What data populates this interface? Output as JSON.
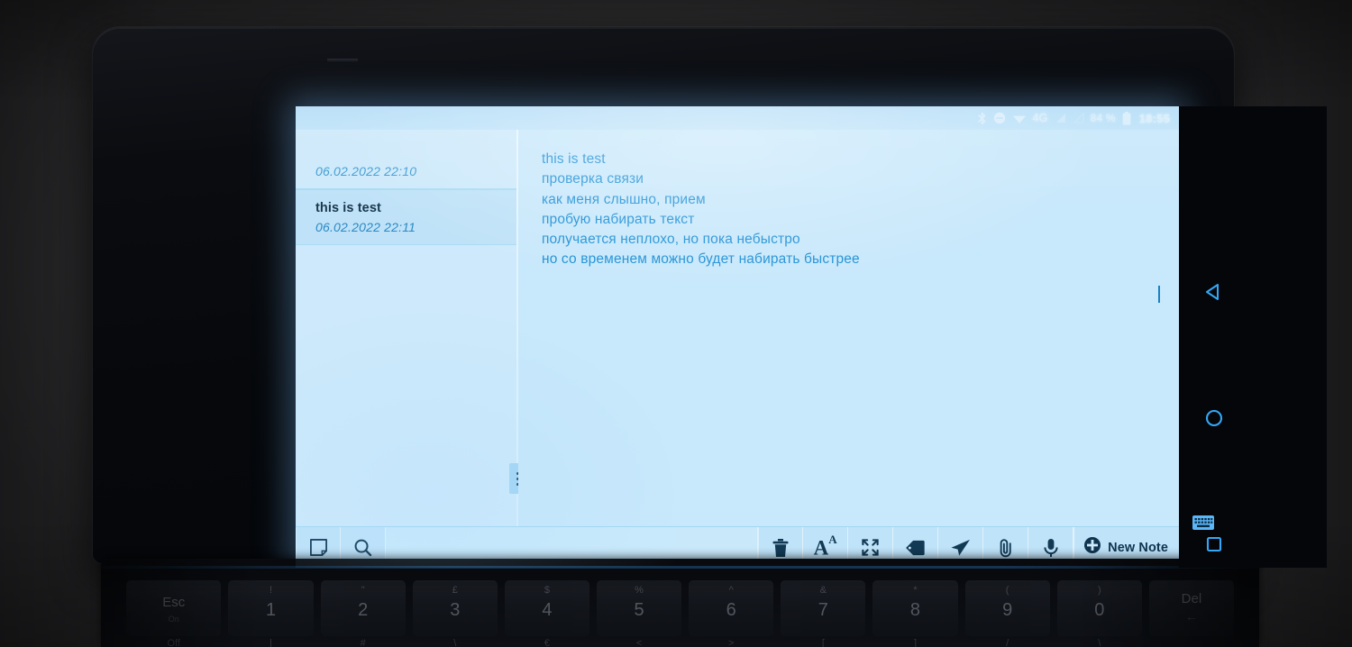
{
  "device": {
    "kind": "foldable-phone-with-keyboard"
  },
  "status_bar": {
    "bluetooth_icon": "bluetooth-icon",
    "dnd_icon": "do-not-disturb-icon",
    "wifi_icon": "wifi-icon",
    "network_label": "4G",
    "signal_icon": "signal-bars-icon",
    "signal_secondary_icon": "signal-bars-secondary-icon",
    "battery_percent": "84 %",
    "battery_icon": "battery-icon",
    "clock": "18:55"
  },
  "notes_list": {
    "items": [
      {
        "title": "",
        "date": "06.02.2022 22:10",
        "selected": false
      },
      {
        "title": "this is test",
        "date": "06.02.2022 22:11",
        "selected": true
      }
    ]
  },
  "editor": {
    "body": "this is test\nпроверка связи\nкак меня слышно, прием\nпробую набирать текст\nполучается неплохо, но пока небыстро\nно со временем можно будет набирать быстрее"
  },
  "toolbar": {
    "left_buttons": [
      {
        "name": "note-icon",
        "label": "Note"
      },
      {
        "name": "search-icon",
        "label": "Search"
      }
    ],
    "right_buttons": [
      {
        "name": "trash-icon",
        "label": "Delete"
      },
      {
        "name": "font-size-icon",
        "label": "Font Size",
        "glyph": "A",
        "glyph_sup": "A"
      },
      {
        "name": "fullscreen-icon",
        "label": "Fullscreen"
      },
      {
        "name": "tag-icon",
        "label": "Tag"
      },
      {
        "name": "send-icon",
        "label": "Send"
      },
      {
        "name": "attachment-icon",
        "label": "Attach"
      },
      {
        "name": "microphone-icon",
        "label": "Voice"
      }
    ],
    "new_note_label": "New Note",
    "new_note_icon": "plus-circle-icon"
  },
  "navbar": {
    "back_icon": "back-triangle-icon",
    "home_icon": "home-circle-icon",
    "recents_icon": "recents-square-icon",
    "keyboard_icon": "keyboard-icon"
  },
  "keyboard": {
    "keys": [
      {
        "main": "Esc",
        "shift": "",
        "sub": "On",
        "alt": "Off",
        "class": "is-esc"
      },
      {
        "main": "1",
        "shift": "!",
        "sub": "",
        "alt": "|",
        "class": ""
      },
      {
        "main": "2",
        "shift": "\"",
        "sub": "",
        "alt": "#",
        "class": ""
      },
      {
        "main": "3",
        "shift": "£",
        "sub": "",
        "alt": "\\",
        "class": ""
      },
      {
        "main": "4",
        "shift": "$",
        "sub": "",
        "alt": "€",
        "class": ""
      },
      {
        "main": "5",
        "shift": "%",
        "sub": "",
        "alt": "<",
        "class": ""
      },
      {
        "main": "6",
        "shift": "^",
        "sub": "",
        "alt": ">",
        "class": ""
      },
      {
        "main": "7",
        "shift": "&",
        "sub": "",
        "alt": "[",
        "class": ""
      },
      {
        "main": "8",
        "shift": "*",
        "sub": "",
        "alt": "]",
        "class": ""
      },
      {
        "main": "9",
        "shift": "(",
        "sub": "",
        "alt": "/",
        "class": ""
      },
      {
        "main": "0",
        "shift": ")",
        "sub": "",
        "alt": "\\",
        "class": ""
      },
      {
        "main": "Del",
        "shift": "",
        "sub": "",
        "alt": "",
        "class": "is-del"
      }
    ]
  },
  "colors": {
    "screen_bg": "#ccebfc",
    "editor_text": "#2091d6",
    "list_selected": "#bfe2f8",
    "toolbar_bg": "#bfe3f9",
    "nav_accent": "#2196f3",
    "bezel": "#06080b"
  }
}
